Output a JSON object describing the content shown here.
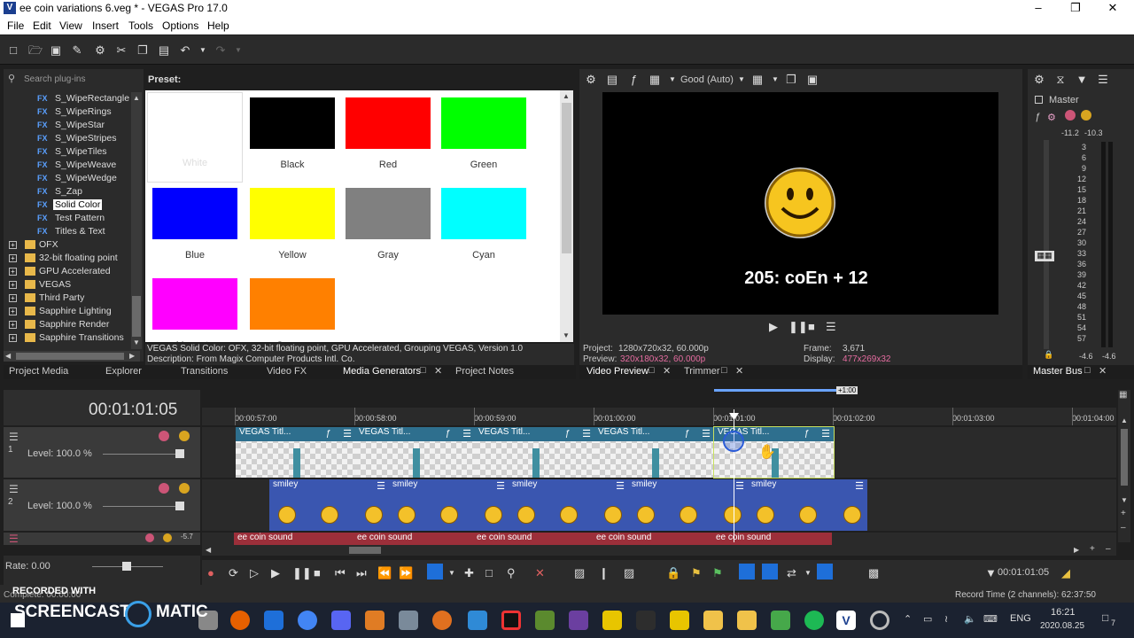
{
  "window": {
    "title": "ee coin variations 6.veg * - VEGAS Pro 17.0",
    "logo": "V",
    "controls": [
      "minimize-icon",
      "restore-icon",
      "close-icon"
    ]
  },
  "menu": [
    "File",
    "Edit",
    "View",
    "Insert",
    "Tools",
    "Options",
    "Help"
  ],
  "plugins": {
    "search_placeholder": "Search plug-ins",
    "fx_items": [
      "S_WipeRectangle",
      "S_WipeRings",
      "S_WipeStar",
      "S_WipeStripes",
      "S_WipeTiles",
      "S_WipeWeave",
      "S_WipeWedge",
      "S_Zap",
      "Solid Color",
      "Test Pattern",
      "Titles & Text"
    ],
    "fx_badge": "FX",
    "selected": "Solid Color",
    "folders": [
      "OFX",
      "32-bit floating point",
      "GPU Accelerated",
      "VEGAS",
      "Third Party",
      "Sapphire Lighting",
      "Sapphire Render",
      "Sapphire Transitions"
    ],
    "preset_label": "Preset:",
    "presets": [
      {
        "name": "White",
        "color": "#ffffff"
      },
      {
        "name": "Black",
        "color": "#000000"
      },
      {
        "name": "Red",
        "color": "#ff0000"
      },
      {
        "name": "Green",
        "color": "#00ff00"
      },
      {
        "name": "Blue",
        "color": "#0000ff"
      },
      {
        "name": "Yellow",
        "color": "#ffff00"
      },
      {
        "name": "Gray",
        "color": "#808080"
      },
      {
        "name": "Cyan",
        "color": "#00ffff"
      },
      {
        "name": "Magenta",
        "color": "#ff00ff"
      },
      {
        "name": "Orange",
        "color": "#ff8000"
      }
    ],
    "description_line1": "VEGAS Solid Color: OFX, 32-bit floating point, GPU Accelerated, Grouping VEGAS, Version 1.0",
    "description_line2": "Description: From Magix Computer Products Intl. Co."
  },
  "left_tabs": [
    "Project Media",
    "Explorer",
    "Transitions",
    "Video FX",
    "Media Generators",
    "Project Notes"
  ],
  "preview": {
    "quality": "Good (Auto)",
    "overlay_text": "205: coEn + 12",
    "project_label": "Project:",
    "project_value": "1280x720x32, 60.000p",
    "preview_label": "Preview:",
    "preview_value": "320x180x32, 60.000p",
    "frame_label": "Frame:",
    "frame_value": "3,671",
    "display_label": "Display:",
    "display_value": "477x269x32",
    "tabs": [
      "Video Preview",
      "Trimmer"
    ]
  },
  "master": {
    "title": "Master",
    "peak_left": "-11.2",
    "peak_right": "-10.3",
    "scale": [
      "3",
      "6",
      "9",
      "12",
      "15",
      "18",
      "21",
      "24",
      "27",
      "30",
      "33",
      "36",
      "39",
      "42",
      "45",
      "48",
      "51",
      "54",
      "57"
    ],
    "bottom_left": "-4.6",
    "bottom_right": "-4.6",
    "tab": "Master Bus"
  },
  "timeline": {
    "timecode": "00:01:01:05",
    "marker": "+1:00",
    "ruler": [
      "00:00:57:00",
      "00:00:58:00",
      "00:00:59:00",
      "00:01:00:00",
      "00:01:01:00",
      "00:01:02:00",
      "00:01:03:00",
      "00:01:04:00"
    ],
    "level_label": "Level: 100.0 %",
    "track_numbers": [
      "1",
      "2"
    ],
    "audio_db": "-5.7",
    "title_event": "VEGAS Titl...",
    "smiley_event": "smiley",
    "sound_event": "ee coin sound",
    "rate_label": "Rate: 0.00",
    "transport_time": "00:01:01:05",
    "record_time": "Record Time (2 channels): 62:37:50"
  },
  "taskbar": {
    "time": "16:21",
    "date": "2020.08.25",
    "lang": "ENG",
    "notifications": "7"
  },
  "watermark": {
    "line1": "RECORDED WITH",
    "line2": "SCREENCAST",
    "line3": "MATIC",
    "complete_label": "Complete: 00:00:00"
  },
  "colors": {
    "accent": "#1e6fd9",
    "title_track": "#2e6f8e",
    "smiley_track": "#3a56b0",
    "sound_track": "#9c2f3a"
  }
}
